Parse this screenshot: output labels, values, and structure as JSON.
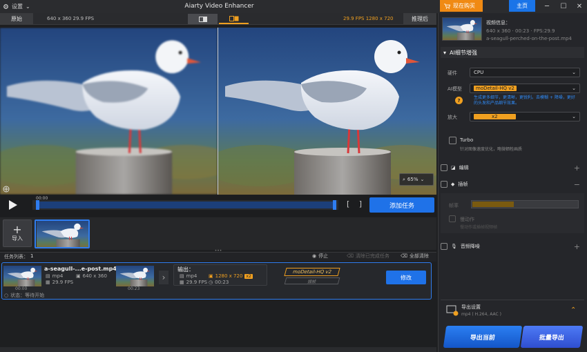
{
  "titlebar": {
    "settings_label": "设置",
    "app_title": "Aiarty Video Enhancer",
    "buy_label": "现在购买",
    "home_label": "主页"
  },
  "preview": {
    "original_label": "原始",
    "original_spec": "640 x 360  29.9 FPS",
    "enhanced_spec": "29.9 FPS  1280 x 720",
    "after_label": "推理后",
    "zoom_value": "65%"
  },
  "timeline": {
    "current_time": "00:00",
    "add_task_label": "添加任务"
  },
  "media": {
    "import_label": "导入"
  },
  "tasklist": {
    "label": "任务列表：",
    "count": "1",
    "stop_label": "停止",
    "clear_finished_label": "清除已完成任务",
    "clear_all_label": "全部清除"
  },
  "task": {
    "name": "a-seagull-...e-post.mp4",
    "input": {
      "format": "mp4",
      "resolution": "640 x 360",
      "fps": "29.9 FPS",
      "duration": "00:23"
    },
    "thumb1_time": "00:00",
    "thumb2_time": "00:23",
    "output_label": "输出：",
    "output": {
      "format": "mp4",
      "resolution": "1280 x 720",
      "scale_badge": "x2",
      "fps": "29.9 FPS",
      "duration": "00:23"
    },
    "model_chip": "moDetail-HQ  v2",
    "frame_chip": "插帧",
    "edit_label": "修改",
    "status": "状态：等待开始"
  },
  "right_panel": {
    "video_info_title": "视频信息：",
    "video_info_spec": "640 x 360 · 00:23 · FPS:29.9",
    "video_info_name": "a-seagull-perched-on-the-post.mp4",
    "ai_section_title": "AI细节增强",
    "hardware_label": "硬件",
    "hardware_value": "CPU",
    "model_label": "AI模型",
    "model_value": "moDetail-HQ  v2",
    "model_desc": "生成更多细节，更清晰，更锐利。去模糊 + 降噪，更好的头发和产品细节效果。",
    "scale_label": "放大",
    "scale_value": "x2",
    "turbo_label": "Turbo",
    "turbo_desc": "针对图像速度优化，略微牺牲画质",
    "edit_section": "编辑",
    "frame_section": "插帧",
    "frame_rate_label": "帧率",
    "frame_motion_label": "慢动作",
    "frame_motion_desc": "慢动作或插帧视频帧",
    "audio_section": "音频降噪",
    "export_title": "导出设置",
    "export_sub": "mp4 ( H.264, AAC )",
    "export_current": "导出当前",
    "export_batch": "批量导出"
  },
  "colors": {
    "accent_blue": "#1f72e8",
    "accent_orange": "#f0a020"
  }
}
